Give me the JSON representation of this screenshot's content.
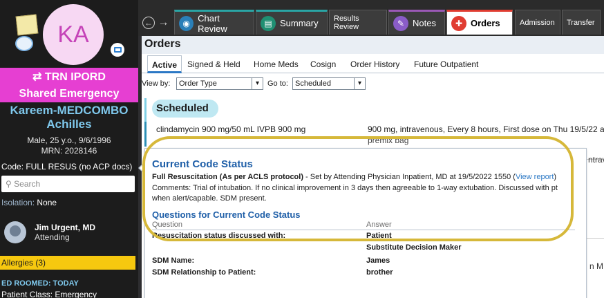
{
  "sidebar": {
    "avatar_initials": "KA",
    "location_banner_line1": "⇄ TRN IPORD",
    "location_banner_line2": "Shared Emergency",
    "patient_name_line1": "Kareem-MEDCOMBO",
    "patient_name_line2": "Achilles",
    "demographics": "Male, 25 y.o., 9/6/1996",
    "mrn": "MRN: 2028146",
    "code_status": "Code: FULL RESUS (no ACP docs)",
    "search_placeholder": "Search",
    "isolation_label": "Isolation:",
    "isolation_value": "None",
    "provider_name": "Jim Urgent, MD",
    "provider_role": "Attending",
    "allergies": "Allergies (3)",
    "ed_roomed": "ED ROOMED: TODAY",
    "patient_class": "Patient Class: Emergency"
  },
  "topbar": {
    "back_icon": "back-arrow-icon",
    "tabs": [
      {
        "label": "Chart Review",
        "icon": "chart-review-icon"
      },
      {
        "label": "Summary",
        "icon": "summary-icon"
      },
      {
        "label": "Results Review",
        "icon": ""
      },
      {
        "label": "Notes",
        "icon": "notes-icon"
      },
      {
        "label": "Orders",
        "icon": "orders-icon"
      },
      {
        "label": "Admission",
        "icon": ""
      },
      {
        "label": "Transfer",
        "icon": ""
      }
    ]
  },
  "main": {
    "title": "Orders",
    "subtabs": [
      "Active",
      "Signed & Held",
      "Home Meds",
      "Cosign",
      "Order History",
      "Future Outpatient"
    ],
    "view_by_label": "View by:",
    "view_by_value": "Order Type",
    "go_to_label": "Go to:",
    "go_to_value": "Scheduled",
    "section": "Scheduled",
    "order": {
      "name": "clindamycin 900 mg/50 mL IVPB 900 mg",
      "detail": "900 mg, intravenous, Every 8 hours, First dose on Thu 19/5/22 at 0",
      "detail2": "premix bag"
    },
    "right_edge_text1": "ntrav",
    "right_edge_text2": "n M"
  },
  "code_status_popup": {
    "title": "Current Code Status",
    "status_bold": "Full Resuscitation (As per ACLS protocol)",
    "status_rest": " - Set by Attending Physician Inpatient, MD at 19/5/2022 1550 (",
    "view_report": "View report",
    "status_close": ")",
    "comments": "Comments: Trial of intubation. If no clinical improvement in 3 days then agreeable to 1-way extubation. Discussed with pt when alert/capable. SDM present.",
    "questions_title": "Questions for Current Code Status",
    "col_question": "Question",
    "col_answer": "Answer",
    "rows": [
      {
        "q": "Resuscitation status discussed with:",
        "a": "Patient"
      },
      {
        "q": "",
        "a": "Substitute Decision Maker"
      },
      {
        "q": "SDM Name:",
        "a": "James"
      },
      {
        "q": "SDM Relationship to Patient:",
        "a": "brother"
      }
    ]
  },
  "colors": {
    "banner": "#e63fd2",
    "allergy": "#f6c80f",
    "link": "#2b78c5",
    "annotation_ring": "#d6b83a"
  }
}
